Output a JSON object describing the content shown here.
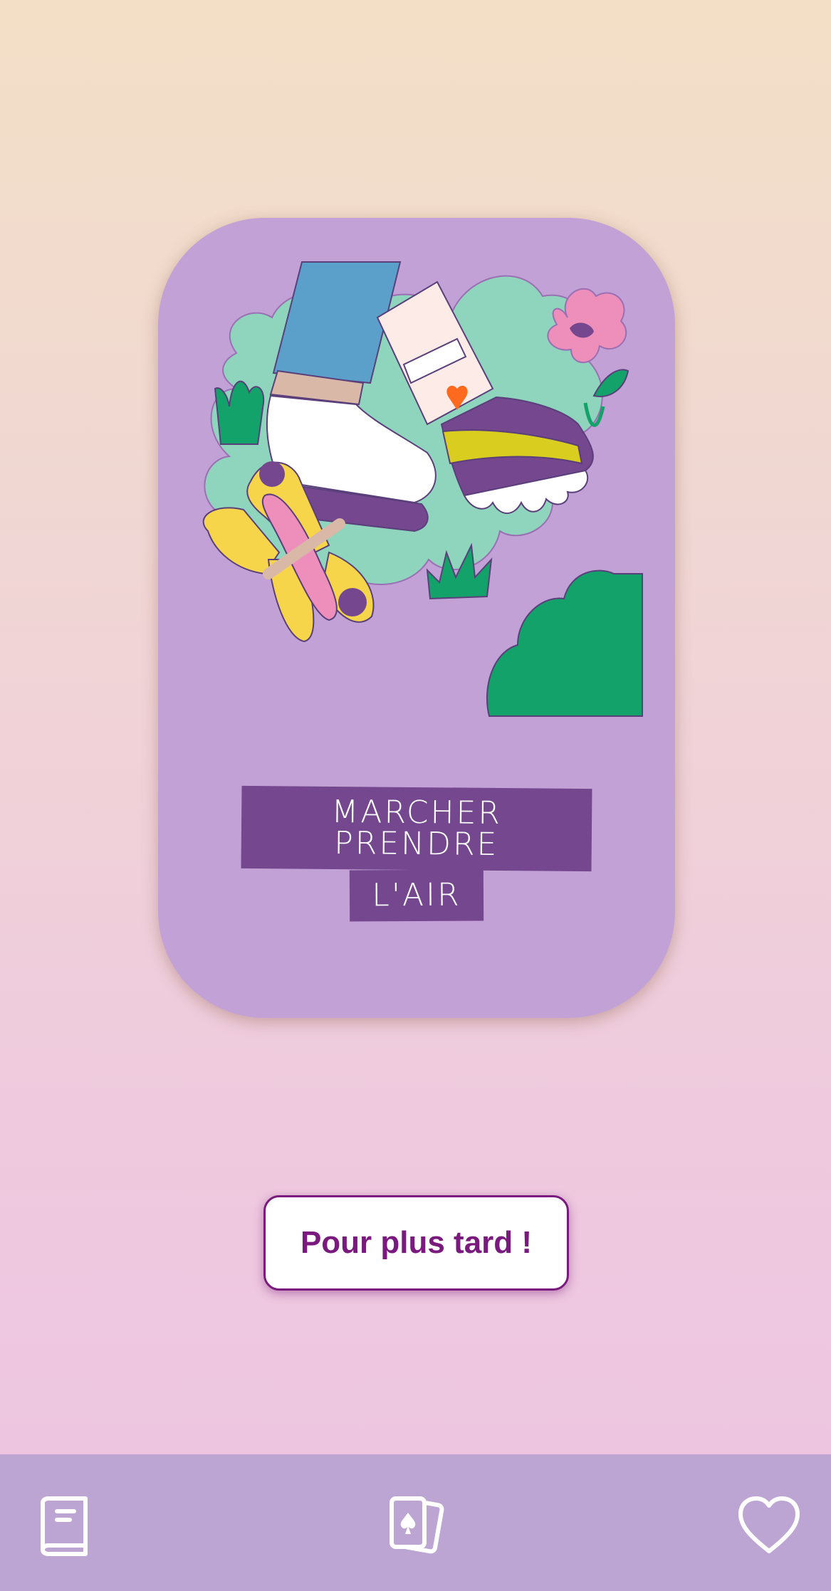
{
  "card": {
    "title_line1": "MARCHER PRENDRE",
    "title_line2": "L'AIR",
    "illustration": "walking-feet-illustration",
    "colors": {
      "background": "#c2a2d6",
      "grass": "#8fd5bd",
      "bush": "#13a269",
      "label_bg": "#74478e"
    }
  },
  "actions": {
    "later_label": "Pour plus tard !"
  },
  "navbar": {
    "items": [
      {
        "icon": "book-icon"
      },
      {
        "icon": "cards-icon"
      },
      {
        "icon": "heart-icon"
      }
    ]
  },
  "colors": {
    "accent": "#7a1a7e",
    "navbar": "#bda5d3"
  }
}
